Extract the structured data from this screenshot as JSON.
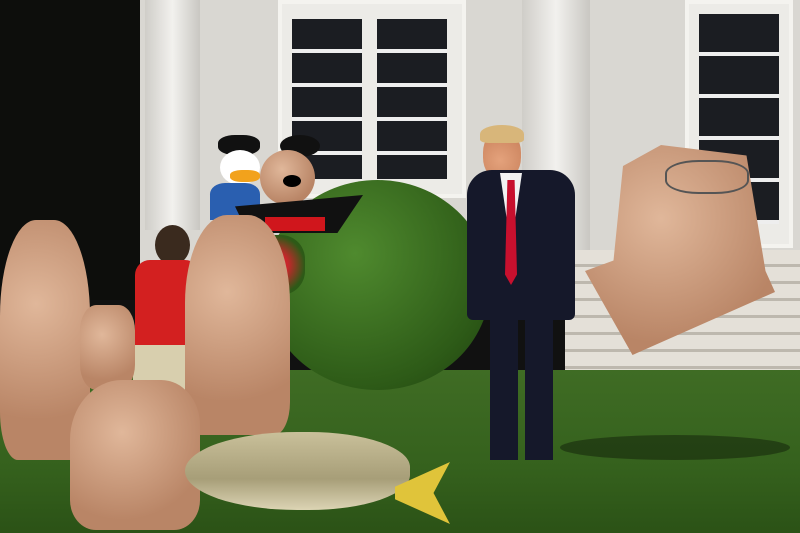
{
  "scene": {
    "colors": {
      "lawn": "#3f6c24",
      "wall": "#d9d7d2",
      "suit": "#15182a",
      "tie": "#c8102e",
      "shirt_red": "#d32020",
      "fish": "#b9b08a",
      "fish_tail": "#e0c43a"
    }
  }
}
